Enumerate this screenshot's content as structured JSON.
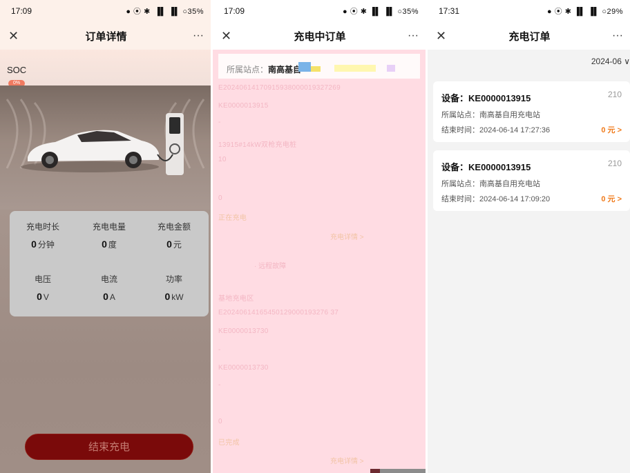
{
  "panel1": {
    "status": {
      "time": "17:09",
      "icons": "● ⦿ ✱  ▐▌ ▐▌ ○35%"
    },
    "nav": {
      "close": "✕",
      "title": "订单详情",
      "more": "···"
    },
    "soc_label": "SOC",
    "soc_badge": "0%",
    "stats": [
      {
        "label": "充电时长",
        "value": "0",
        "unit": "分钟"
      },
      {
        "label": "充电电量",
        "value": "0",
        "unit": "度"
      },
      {
        "label": "充电金额",
        "value": "0",
        "unit": "元"
      },
      {
        "label": "电压",
        "value": "0",
        "unit": "V"
      },
      {
        "label": "电流",
        "value": "0",
        "unit": "A"
      },
      {
        "label": "功率",
        "value": "0",
        "unit": "kW"
      }
    ],
    "end_button": "结束充电"
  },
  "panel2": {
    "status": {
      "time": "17:09",
      "icons": "● ⦿ ✱ ▐▌ ▐▌ ○35%"
    },
    "nav": {
      "close": "✕",
      "title": "充电中订单",
      "more": "···"
    },
    "station_label": "所属站点：",
    "station_value": "南高基自",
    "faint_lines": [
      "E20240614170915938000019327269",
      "KE0000013915",
      "-",
      "13915#14kW双枪充电桩",
      "10",
      "0",
      "正在充电",
      "基地充电区",
      "E20240614165450129000193276 37",
      "KE0000013730",
      "-",
      "KE0000013730",
      "-",
      "0",
      "已完成"
    ],
    "faint_right_1": "充电详情 >",
    "faint_center": "· 远程故障",
    "faint_right_2": "充电详情 >"
  },
  "panel3": {
    "status": {
      "time": "17:31",
      "icons": "● ⦿ ✱ ▐▌ ▐▌ ○29%"
    },
    "nav": {
      "close": "✕",
      "title": "充电订单",
      "more": "···"
    },
    "date_filter": "2024-06 ∨",
    "orders": [
      {
        "device_label": "设备：",
        "device": "KE0000013915",
        "number": "210",
        "station_label": "所属站点：",
        "station": "南高基自用充电站",
        "end_label": "结束时间：",
        "end_time": "2024-06-14 17:27:36",
        "amount": "0 元 >"
      },
      {
        "device_label": "设备：",
        "device": "KE0000013915",
        "number": "210",
        "station_label": "所属站点：",
        "station": "南高基自用充电站",
        "end_label": "结束时间：",
        "end_time": "2024-06-14 17:09:20",
        "amount": "0 元 >"
      }
    ]
  },
  "colors": {
    "panel2_bg": "#ffdce3",
    "end_button": "#7a0a0a",
    "amount_orange": "#f07a1a"
  }
}
